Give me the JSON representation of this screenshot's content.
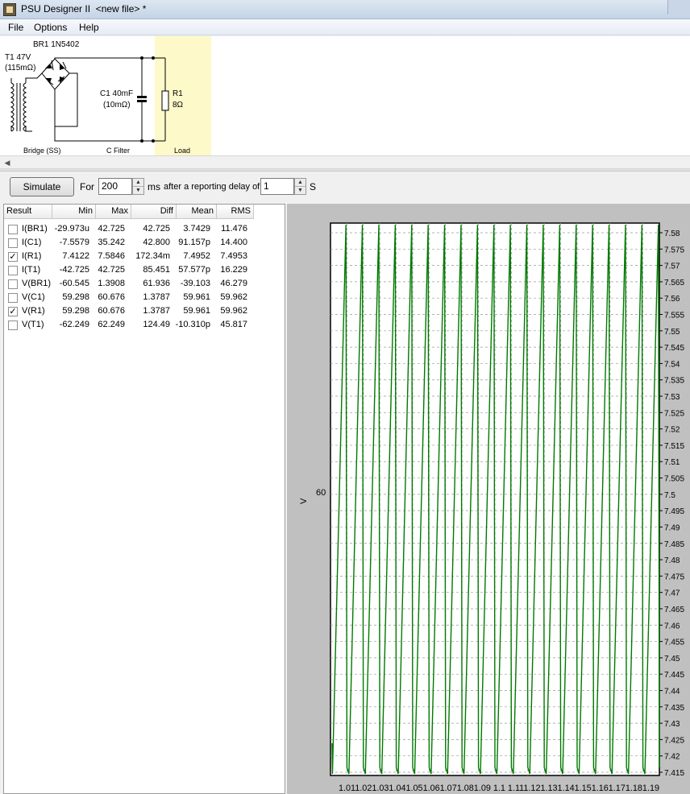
{
  "window": {
    "title": "PSU Designer II  <new file> *"
  },
  "menu": {
    "items": [
      "File",
      "Options",
      "Help"
    ]
  },
  "schematic": {
    "bridge_part": "BR1 1N5402",
    "transformer_name": "T1 47V",
    "transformer_res": "(115mΩ)",
    "cap_name": "C1 40mF",
    "cap_res": "(10mΩ)",
    "load_name": "R1",
    "load_value": "8Ω",
    "section_bridge": "Bridge (SS)",
    "section_filter": "C Filter",
    "section_load": "Load"
  },
  "controls": {
    "simulate_label": "Simulate",
    "for_label": "For",
    "duration_value": "200",
    "ms_label": "ms",
    "delay_label": "after a reporting delay of",
    "delay_value": "1",
    "s_label": "S"
  },
  "results": {
    "columns": [
      "Result",
      "Min",
      "Max",
      "Diff",
      "Mean",
      "RMS"
    ],
    "rows": [
      {
        "checked": false,
        "name": "I(BR1)",
        "min": "-29.973u",
        "max": "42.725",
        "diff": "42.725",
        "mean": "3.7429",
        "rms": "11.476"
      },
      {
        "checked": false,
        "name": "I(C1)",
        "min": "-7.5579",
        "max": "35.242",
        "diff": "42.800",
        "mean": "91.157p",
        "rms": "14.400"
      },
      {
        "checked": true,
        "name": "I(R1)",
        "min": "7.4122",
        "max": "7.5846",
        "diff": "172.34m",
        "mean": "7.4952",
        "rms": "7.4953"
      },
      {
        "checked": false,
        "name": "I(T1)",
        "min": "-42.725",
        "max": "42.725",
        "diff": "85.451",
        "mean": "57.577p",
        "rms": "16.229"
      },
      {
        "checked": false,
        "name": "V(BR1)",
        "min": "-60.545",
        "max": "1.3908",
        "diff": "61.936",
        "mean": "-39.103",
        "rms": "46.279"
      },
      {
        "checked": false,
        "name": "V(C1)",
        "min": "59.298",
        "max": "60.676",
        "diff": "1.3787",
        "mean": "59.961",
        "rms": "59.962"
      },
      {
        "checked": true,
        "name": "V(R1)",
        "min": "59.298",
        "max": "60.676",
        "diff": "1.3787",
        "mean": "59.961",
        "rms": "59.962"
      },
      {
        "checked": false,
        "name": "V(T1)",
        "min": "-62.249",
        "max": "62.249",
        "diff": "124.49",
        "mean": "-10.310p",
        "rms": "45.817"
      }
    ]
  },
  "chart_data": {
    "type": "line",
    "ylabel": "V",
    "y_left_tick": "60",
    "right_ylim": [
      7.415,
      7.58
    ],
    "right_ticks": [
      "7.58",
      "7.575",
      "7.57",
      "7.565",
      "7.56",
      "7.555",
      "7.55",
      "7.545",
      "7.54",
      "7.535",
      "7.53",
      "7.525",
      "7.52",
      "7.515",
      "7.51",
      "7.505",
      "7.5",
      "7.495",
      "7.49",
      "7.485",
      "7.48",
      "7.475",
      "7.47",
      "7.465",
      "7.46",
      "7.455",
      "7.45",
      "7.445",
      "7.44",
      "7.435",
      "7.43",
      "7.425",
      "7.42",
      "7.415"
    ],
    "x_tick_text": "1.011.021.031.041.051.061.071.081.09 1.1 1.111.121.131.141.151.161.171.181.19",
    "xlim": [
      1.0,
      1.2
    ],
    "ripple_cycles": 20,
    "grid": true,
    "series_color": "#007a00"
  }
}
